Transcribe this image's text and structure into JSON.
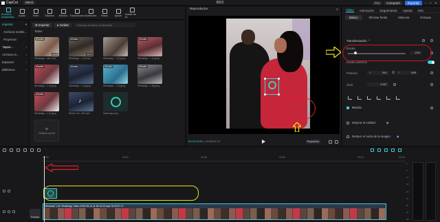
{
  "app": {
    "logo_text": "CapCut",
    "menu_label": "Menú",
    "project_title": "0812",
    "pro_label": "Pro",
    "share_label": "Compartir",
    "export_label": "Exportar"
  },
  "toolbar": {
    "items": [
      {
        "label": "Archivos multimedia",
        "icon": "media-icon"
      },
      {
        "label": "Audio",
        "icon": "audio-icon"
      },
      {
        "label": "Texto",
        "icon": "text-icon"
      },
      {
        "label": "Stickers",
        "icon": "sticker-icon"
      },
      {
        "label": "Efectos",
        "icon": "effects-icon"
      },
      {
        "label": "Transiciones",
        "icon": "transition-icon"
      },
      {
        "label": "Subtítulos",
        "icon": "captions-icon"
      },
      {
        "label": "Filtros",
        "icon": "filter-icon"
      },
      {
        "label": "Ajuste",
        "icon": "adjust-icon"
      },
      {
        "label": "Avatar de IA",
        "icon": "ai-avatar-icon"
      }
    ],
    "active_index": 0
  },
  "sidebar": {
    "items": [
      {
        "label": "Importar",
        "active": true
      },
      {
        "label": "Archivos multim...",
        "active": false
      },
      {
        "label": "Proyectos secun...",
        "active": false
      },
      {
        "label": "Tuyos",
        "active": false
      },
      {
        "label": "Archivos m...",
        "active": false
      },
      {
        "label": "Espacios",
        "active": false
      },
      {
        "label": "Biblioteca",
        "active": false
      }
    ]
  },
  "media": {
    "import_label": "Importar",
    "record_label": "Grabar",
    "search_placeholder": "Buscar archivos multimedia",
    "section_label": "Todos",
    "added_badge": "Añadido",
    "generate_label": "Generar con IA",
    "items": [
      {
        "caption": "WhatsApp...ideo.mp4",
        "duration": "00:25",
        "added": true
      },
      {
        "caption": "WhatsApp...1 (3).mp4",
        "duration": "00:17",
        "added": true
      },
      {
        "caption": "WhatsApp...1 (2).jpeg",
        "duration": "",
        "added": false
      },
      {
        "caption": "WhatsApp...1 (1).jpeg",
        "duration": "",
        "added": true
      },
      {
        "caption": "WhatsApp...1 (2).jpeg",
        "duration": "",
        "added": true
      },
      {
        "caption": "WhatsApp...1 (4).jpeg",
        "duration": "",
        "added": true
      },
      {
        "caption": "WhatsApp...1 (4).jpeg",
        "duration": "",
        "added": true
      },
      {
        "caption": "WhatsApp...1 (5).jpeg",
        "duration": "",
        "added": true
      },
      {
        "caption": "WhatsApp...1 (1).jpeg",
        "duration": "",
        "added": true
      },
      {
        "caption": "Wears You...Me.mp3",
        "duration": "",
        "added": false
      },
      {
        "caption": "steamlogo.png",
        "duration": "",
        "added": false
      }
    ]
  },
  "player": {
    "title": "Reproductor",
    "current_time": "00:00:00:00",
    "total_time": "00:00:57:17",
    "proportion_label": "Proporción"
  },
  "panel": {
    "tabs": [
      "Video",
      "Animación",
      "Seguimiento",
      "Ajustar",
      "Esti"
    ],
    "active_tab": 0,
    "subtabs": [
      "Básico",
      "Eliminar fondo",
      "Máscara",
      "Retoque"
    ],
    "active_subtab": 0,
    "transform_label": "Transformación",
    "scale_label": "Escala",
    "scale_value": "13%",
    "scale_fraction": 0.13,
    "uniform_scale_label": "Escala uniforme",
    "position_label": "Posición",
    "pos_x_label": "X",
    "pos_x_value": "841",
    "pos_y_label": "Y",
    "pos_y_value": "-495",
    "rotate_label": "Girar",
    "rotate_value": "0.00°",
    "blend_label": "Mezcla",
    "quality_label": "Mejorar la calidad",
    "noise_label": "Reducir el ruido de la imagen"
  },
  "timeline": {
    "ticks": [
      "00:00",
      "00:03",
      "00:06",
      "00:09",
      "00:12",
      "00:15"
    ],
    "main_clip_label": "Velocidad 1,4X   WhatsApp Video 2025-08-12 at 18.18.33.mp4  00:00:57:17",
    "cover_label": "Portada",
    "meter_scale": [
      "0",
      "-6",
      "-12",
      "-18",
      "-24",
      "-30",
      "-36",
      "-42",
      "-48"
    ]
  },
  "colors": {
    "accent": "#3fd0d6",
    "annotation_red": "#e0222a",
    "annotation_yellow": "#e9e210",
    "export_blue": "#2a6ee6"
  }
}
